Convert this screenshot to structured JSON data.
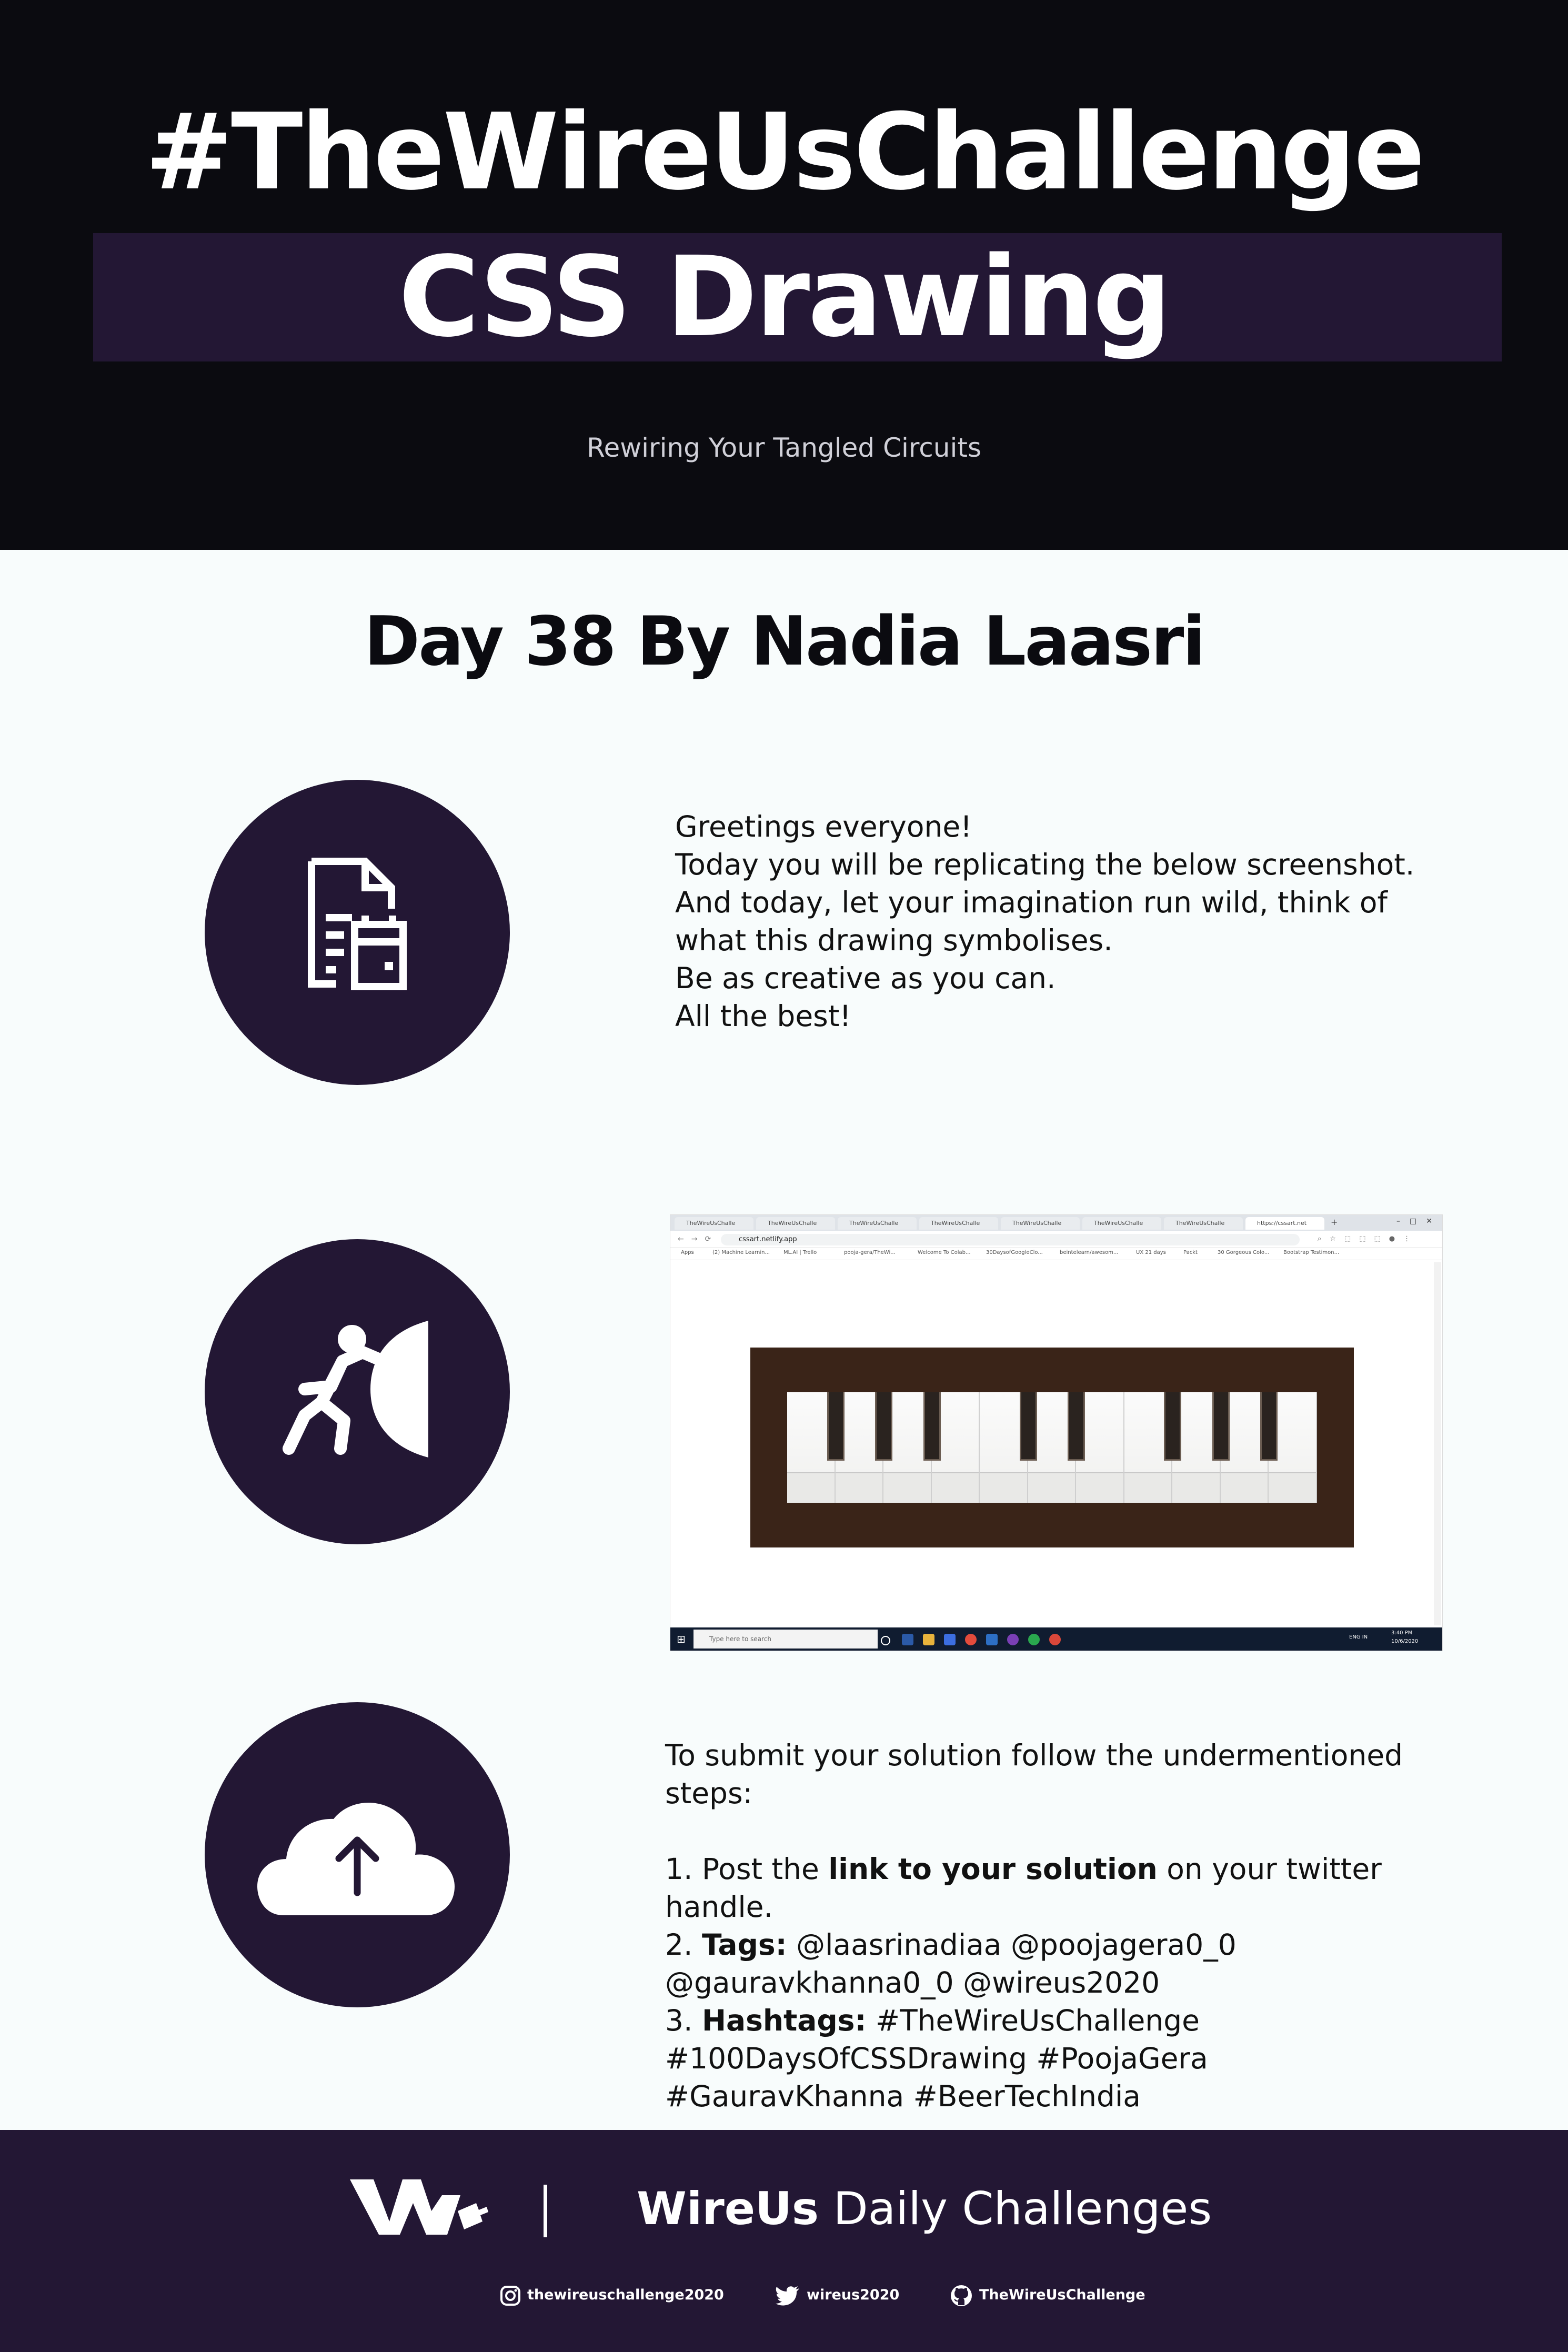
{
  "header": {
    "title": "#TheWireUsChallenge",
    "subtitle": "CSS Drawing",
    "tagline": "Rewiring Your Tangled Circuits"
  },
  "day_title": "Day 38 By Nadia Laasri",
  "sections": {
    "instructions": {
      "icon": "document-calendar-icon",
      "lines": [
        "Greetings everyone!",
        "Today you will be replicating the below screenshot.",
        "And today, let your imagination run wild, think of what this drawing symbolises.",
        "Be as creative as you can.",
        "All the best!"
      ]
    },
    "challenge": {
      "icon": "person-pushing-wall-icon",
      "screenshot": {
        "tabs": [
          "TheWireUsChalle",
          "TheWireUsChalle",
          "TheWireUsChalle",
          "TheWireUsChalle",
          "TheWireUsChalle",
          "TheWireUsChalle",
          "TheWireUsChalle",
          "https://cssart.net"
        ],
        "url": "cssart.netlify.app",
        "bookmarks": [
          "Apps",
          "(2) Machine Learnin...",
          "ML.AI | Trello",
          "pooja-gera/TheWi...",
          "Welcome To Colab...",
          "30DaysofGoogleClo...",
          "beintelearn/awesom...",
          "UX 21 days",
          "Packt",
          "30 Gorgeous Colo...",
          "Bootstrap Testimon..."
        ],
        "search_placeholder": "Type here to search",
        "tray_lang": "ENG IN",
        "tray_time": "3:40 PM",
        "tray_date": "10/6/2020"
      }
    },
    "submit": {
      "icon": "cloud-upload-icon",
      "intro": "To submit your solution follow the undermentioned steps:",
      "step1_pre": "1. Post the ",
      "step1_bold": "link to your solution",
      "step1_post": " on your twitter handle.",
      "step2_label": "Tags:",
      "step2_pre": "2. ",
      "step2_text": " @laasrinadiaa @poojagera0_0 @gauravkhanna0_0 @wireus2020",
      "step3_pre": "3. ",
      "step3_label": "Hashtags:",
      "step3_text": " #TheWireUsChallenge #100DaysOfCSSDrawing #PoojaGera #GauravKhanna #BeerTechIndia"
    }
  },
  "footer": {
    "brand_bold": "WireUs",
    "brand_rest": " Daily Challenges",
    "social": [
      {
        "icon": "instagram-icon",
        "handle": "thewireuschallenge2020"
      },
      {
        "icon": "twitter-icon",
        "handle": "wireus2020"
      },
      {
        "icon": "github-icon",
        "handle": "TheWireUsChallenge"
      }
    ]
  },
  "colors": {
    "header_bg": "#0b0b10",
    "accent_purple": "#231734",
    "page_bg": "#f8fcfc",
    "piano_frame": "#3a2418"
  }
}
